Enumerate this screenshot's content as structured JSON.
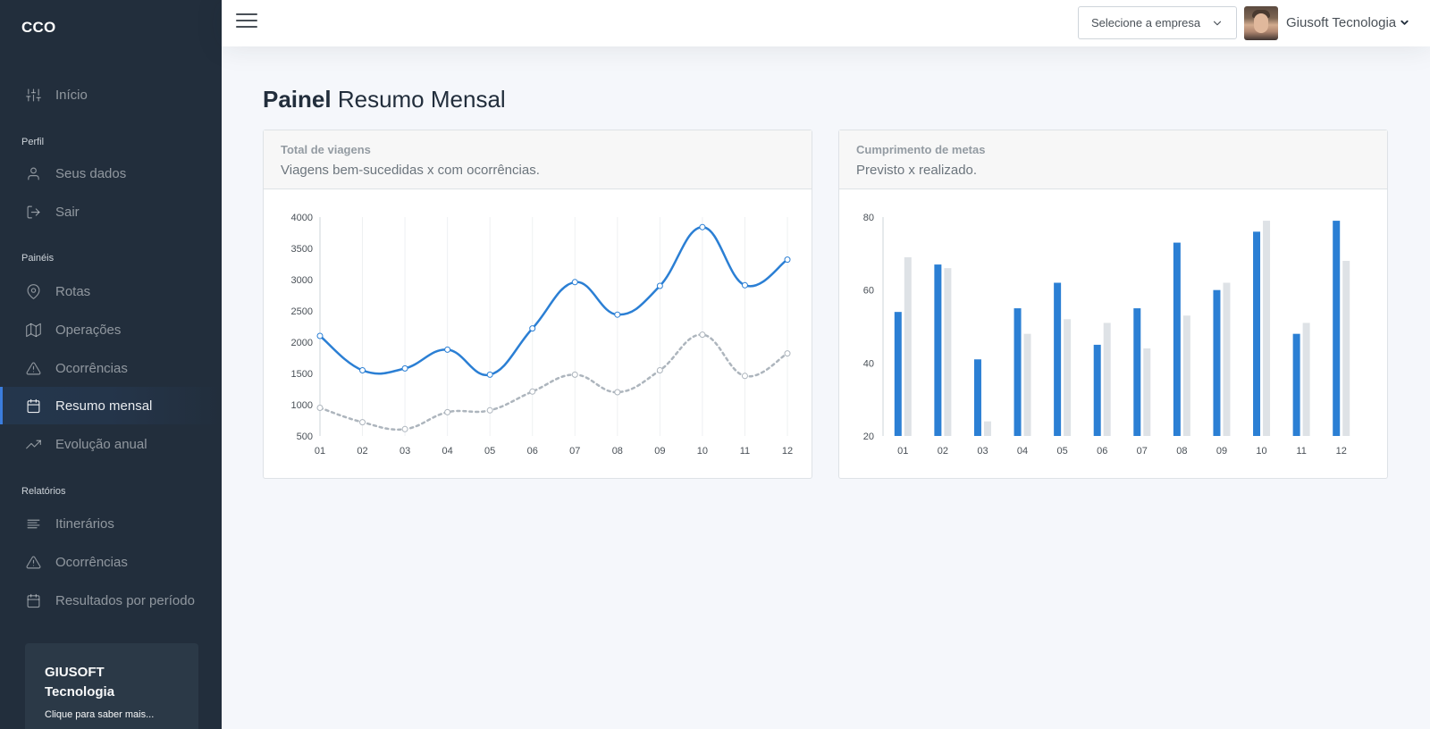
{
  "app": {
    "brand": "CCO"
  },
  "sidebar": {
    "top_items": [
      {
        "label": "Início",
        "icon": "sliders-icon"
      }
    ],
    "sections": [
      {
        "header": "Perfil",
        "items": [
          {
            "label": "Seus dados",
            "icon": "user-icon"
          },
          {
            "label": "Sair",
            "icon": "log-out-icon"
          }
        ]
      },
      {
        "header": "Painéis",
        "items": [
          {
            "label": "Rotas",
            "icon": "map-pin-icon"
          },
          {
            "label": "Operações",
            "icon": "map-icon"
          },
          {
            "label": "Ocorrências",
            "icon": "alert-triangle-icon"
          },
          {
            "label": "Resumo mensal",
            "icon": "calendar-icon",
            "active": true
          },
          {
            "label": "Evolução anual",
            "icon": "trending-up-icon"
          }
        ]
      },
      {
        "header": "Relatórios",
        "items": [
          {
            "label": "Itinerários",
            "icon": "align-left-icon"
          },
          {
            "label": "Ocorrências",
            "icon": "alert-triangle-icon"
          },
          {
            "label": "Resultados por período",
            "icon": "calendar-icon"
          }
        ]
      }
    ],
    "cta": {
      "title": "GIUSOFT Tecnologia",
      "subtitle": "Clique para saber mais..."
    }
  },
  "topbar": {
    "company_placeholder": "Selecione a empresa",
    "user_name": "Giusoft Tecnologia"
  },
  "page": {
    "title_bold": "Painel",
    "title_rest": "Resumo Mensal"
  },
  "cards": {
    "trips": {
      "title": "Total de viagens",
      "subtitle": "Viagens bem-sucedidas x com ocorrências."
    },
    "goals": {
      "title": "Cumprimento de metas",
      "subtitle": "Previsto x realizado."
    }
  },
  "colors": {
    "primary": "#2b7fd4",
    "secondary": "#adb5bd",
    "bar_light": "#dee2e6",
    "sidebar_bg": "#222e3c"
  },
  "chart_data": [
    {
      "type": "line",
      "categories": [
        "01",
        "02",
        "03",
        "04",
        "05",
        "06",
        "07",
        "08",
        "09",
        "10",
        "11",
        "12"
      ],
      "series": [
        {
          "values": [
            2100,
            1550,
            1580,
            1880,
            1480,
            2220,
            2960,
            2440,
            2900,
            3840,
            2910,
            3320
          ]
        },
        {
          "values": [
            950,
            720,
            610,
            880,
            910,
            1210,
            1480,
            1200,
            1550,
            2120,
            1460,
            1820
          ]
        }
      ],
      "yticks": [
        500,
        1000,
        1500,
        2000,
        2500,
        3000,
        3500,
        4000
      ],
      "ylim": [
        500,
        4000
      ],
      "grid": "vertical"
    },
    {
      "type": "bar",
      "categories": [
        "01",
        "02",
        "03",
        "04",
        "05",
        "06",
        "07",
        "08",
        "09",
        "10",
        "11",
        "12"
      ],
      "series": [
        {
          "values": [
            54,
            67,
            41,
            55,
            62,
            45,
            55,
            73,
            60,
            76,
            48,
            79
          ]
        },
        {
          "values": [
            69,
            66,
            24,
            48,
            52,
            51,
            44,
            53,
            62,
            79,
            51,
            68
          ]
        }
      ],
      "yticks": [
        20,
        40,
        60,
        80
      ],
      "ylim": [
        20,
        80
      ]
    }
  ]
}
